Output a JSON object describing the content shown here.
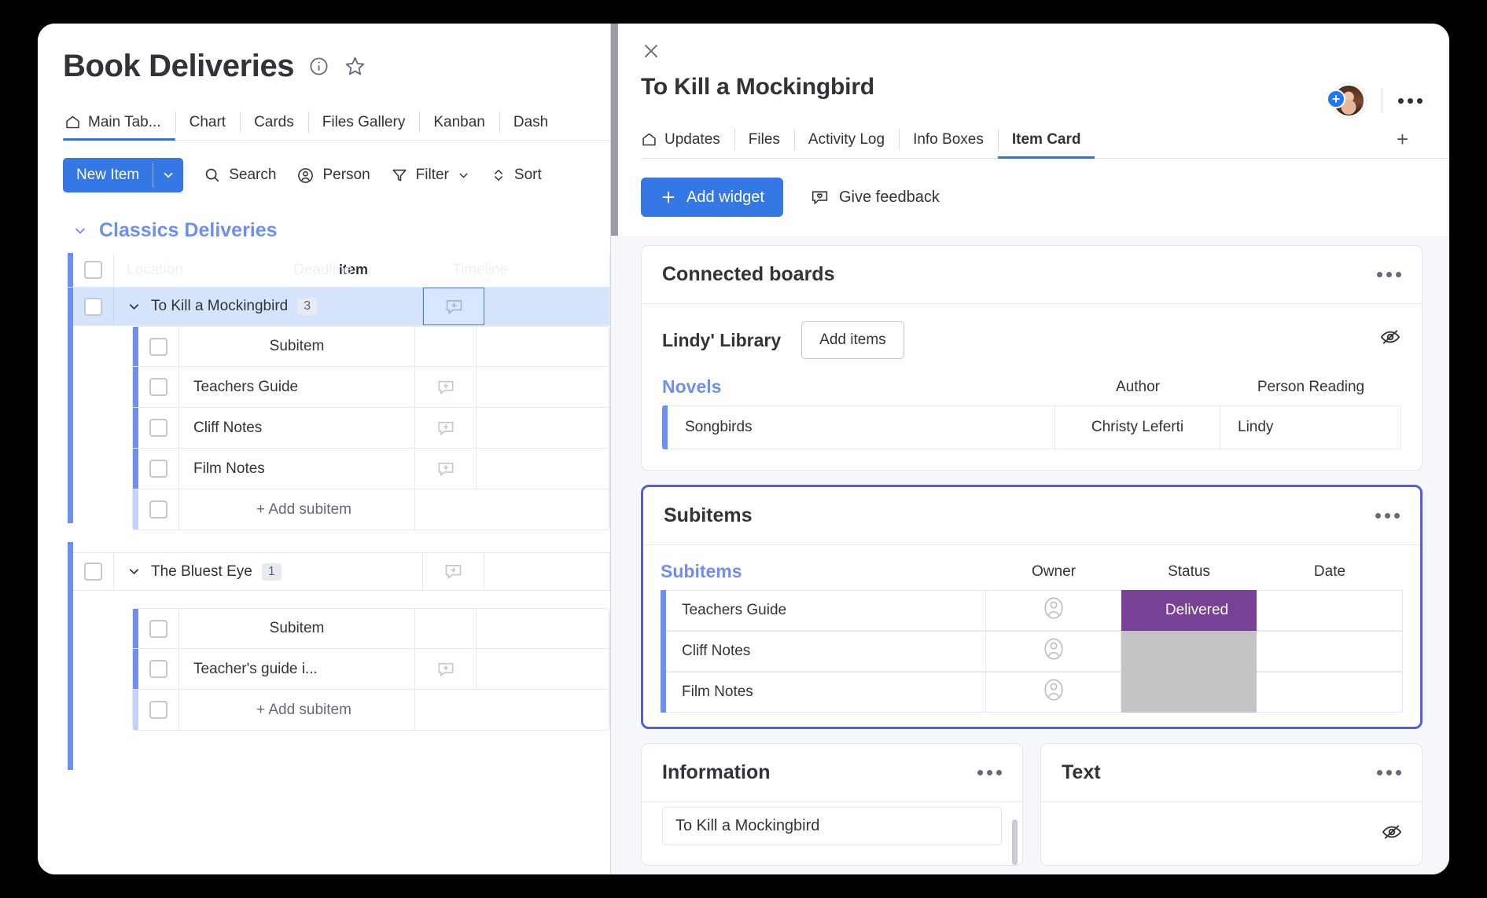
{
  "board": {
    "title": "Book Deliveries",
    "icons": {
      "info": "info-icon",
      "star": "star-icon"
    },
    "view_tabs": [
      {
        "label": "Main Tab...",
        "icon": "home-icon",
        "active": true
      },
      {
        "label": "Chart",
        "active": false
      },
      {
        "label": "Cards",
        "active": false
      },
      {
        "label": "Files Gallery",
        "active": false
      },
      {
        "label": "Kanban",
        "active": false
      },
      {
        "label": "Dash",
        "active": false
      }
    ],
    "toolbar": {
      "new_item": "New Item",
      "search": "Search",
      "person": "Person",
      "filter": "Filter",
      "sort": "Sort"
    },
    "group": {
      "name": "Classics Deliveries"
    },
    "columns_ghost": [
      "Location",
      "Deadline",
      "Timeline"
    ],
    "columns": {
      "item": "Item",
      "subitem": "Subitem"
    },
    "items": [
      {
        "name": "To Kill a Mockingbird",
        "count": "3",
        "selected": true,
        "subitems": [
          "Teachers Guide",
          "Cliff Notes",
          "Film Notes"
        ],
        "add_subitem": "+ Add subitem"
      },
      {
        "name": "The Bluest Eye",
        "count": "1",
        "selected": false,
        "subitems": [
          "Teacher's guide i..."
        ],
        "add_subitem": "+ Add subitem"
      }
    ]
  },
  "panel": {
    "close": "close-icon",
    "item_title": "To Kill a Mockingbird",
    "avatar_plus": "+",
    "tabs": [
      {
        "label": "Updates",
        "icon": "home-icon",
        "active": false
      },
      {
        "label": "Files",
        "active": false
      },
      {
        "label": "Activity Log",
        "active": false
      },
      {
        "label": "Info Boxes",
        "active": false
      },
      {
        "label": "Item Card",
        "active": true
      }
    ],
    "add_tab": "+",
    "add_widget": "Add widget",
    "give_feedback": "Give feedback",
    "widgets": {
      "connected_boards": {
        "title": "Connected boards",
        "board_name": "Lindy' Library",
        "add_items": "Add items",
        "table": {
          "title_column": "Novels",
          "columns": [
            "Author",
            "Person Reading"
          ],
          "rows": [
            {
              "name": "Songbirds",
              "author": "Christy Leferti",
              "person_reading": "Lindy"
            }
          ]
        }
      },
      "subitems": {
        "title": "Subitems",
        "table": {
          "title_column": "Subitems",
          "columns": [
            "Owner",
            "Status",
            "Date"
          ],
          "rows": [
            {
              "name": "Teachers Guide",
              "owner": "",
              "status": "Delivered",
              "status_color": "#784195",
              "date": ""
            },
            {
              "name": "Cliff Notes",
              "owner": "",
              "status": "",
              "status_color": "#c4c4c4",
              "date": ""
            },
            {
              "name": "Film Notes",
              "owner": "",
              "status": "",
              "status_color": "#c4c4c4",
              "date": ""
            }
          ]
        }
      },
      "information": {
        "title": "Information",
        "field_value": "To Kill a Mockingbird"
      },
      "text": {
        "title": "Text"
      }
    }
  },
  "colors": {
    "primary_blue": "#3577e5",
    "accent_blue": "#6f8ff0",
    "focus_purple": "#5a5ae0",
    "status_delivered": "#784195",
    "status_empty": "#c4c4c4"
  }
}
